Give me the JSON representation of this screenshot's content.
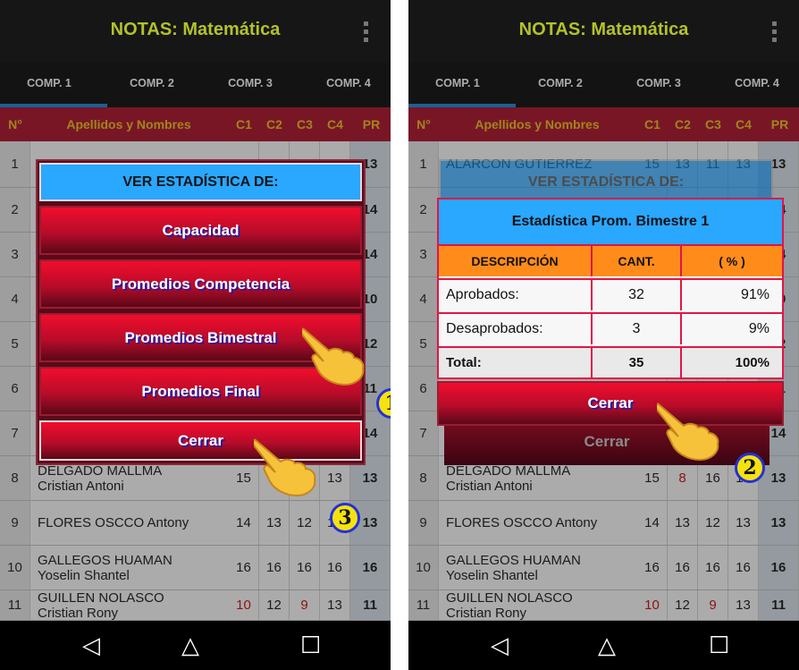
{
  "app": {
    "title": "NOTAS: Matemática"
  },
  "tabs": [
    "COMP. 1",
    "COMP. 2",
    "COMP. 3",
    "COMP. 4"
  ],
  "grid": {
    "headers": {
      "n": "N°",
      "name": "Apellidos y Nombres",
      "c1": "C1",
      "c2": "C2",
      "c3": "C3",
      "c4": "C4",
      "pr": "PR"
    },
    "rows": [
      {
        "n": "1",
        "name1": "ALARCON GUTIERREZ",
        "name2": "",
        "c1": "15",
        "c2": "13",
        "c3": "11",
        "c4": "13",
        "pr": "13"
      },
      {
        "n": "2",
        "name1": "",
        "name2": "",
        "c1": "",
        "c2": "",
        "c3": "",
        "c4": "",
        "pr": "14"
      },
      {
        "n": "3",
        "name1": "",
        "name2": "",
        "c1": "",
        "c2": "",
        "c3": "",
        "c4": "",
        "pr": "14"
      },
      {
        "n": "4",
        "name1": "",
        "name2": "",
        "c1": "",
        "c2": "",
        "c3": "",
        "c4": "",
        "pr": "10"
      },
      {
        "n": "5",
        "name1": "",
        "name2": "",
        "c1": "",
        "c2": "",
        "c3": "",
        "c4": "",
        "pr": "12"
      },
      {
        "n": "6",
        "name1": "",
        "name2": "",
        "c1": "",
        "c2": "",
        "c3": "",
        "c4": "",
        "pr": "11"
      },
      {
        "n": "7",
        "name1": "",
        "name2": "",
        "c1": "",
        "c2": "",
        "c3": "",
        "c4": "",
        "pr": "14"
      },
      {
        "n": "8",
        "name1": "DELGADO MALLMA",
        "name2": "Cristian Antoni",
        "c1": "15",
        "c2": "8",
        "c3": "16",
        "c4": "13",
        "pr": "13"
      },
      {
        "n": "9",
        "name1": "FLORES OSCCO  Antony",
        "name2": "",
        "c1": "14",
        "c2": "13",
        "c3": "12",
        "c4": "13",
        "pr": "13"
      },
      {
        "n": "10",
        "name1": "GALLEGOS HUAMAN",
        "name2": "Yoselin Shantel",
        "c1": "16",
        "c2": "16",
        "c3": "16",
        "c4": "16",
        "pr": "16"
      },
      {
        "n": "11",
        "name1": "GUILLEN NOLASCO",
        "name2": "Cristian Rony",
        "c1": "10",
        "c2": "12",
        "c3": "9",
        "c4": "13",
        "pr": "11"
      }
    ]
  },
  "menu": {
    "heading": "VER ESTADÍSTICA DE:",
    "items": [
      "Capacidad",
      "Promedios Competencia",
      "Promedios Bimestral",
      "Promedios Final"
    ],
    "close": "Cerrar"
  },
  "stats": {
    "title": "Estadística Prom. Bimestre 1",
    "columns": [
      "DESCRIPCIÓN",
      "CANT.",
      "( % )"
    ],
    "rows": [
      {
        "desc": "Aprobados:",
        "cant": "32",
        "pct": "91%"
      },
      {
        "desc": "Desaprobados:",
        "cant": "3",
        "pct": "9%"
      }
    ],
    "total": {
      "desc": "Total:",
      "cant": "35",
      "pct": "100%"
    },
    "close": "Cerrar"
  },
  "badges": [
    "1",
    "2",
    "3"
  ],
  "navbar": {
    "back": "◁",
    "home": "△",
    "recents": "☐"
  },
  "colors": {
    "accent": "#b3c229",
    "header_red": "#b3223a",
    "button_red": "#f10d2c",
    "modal_blue": "#2aa7ff",
    "table_orange": "#ff8c1a"
  },
  "icons": [
    "kebab-menu-icon",
    "pointing-hand-icon",
    "back-icon",
    "home-icon",
    "recents-icon"
  ]
}
